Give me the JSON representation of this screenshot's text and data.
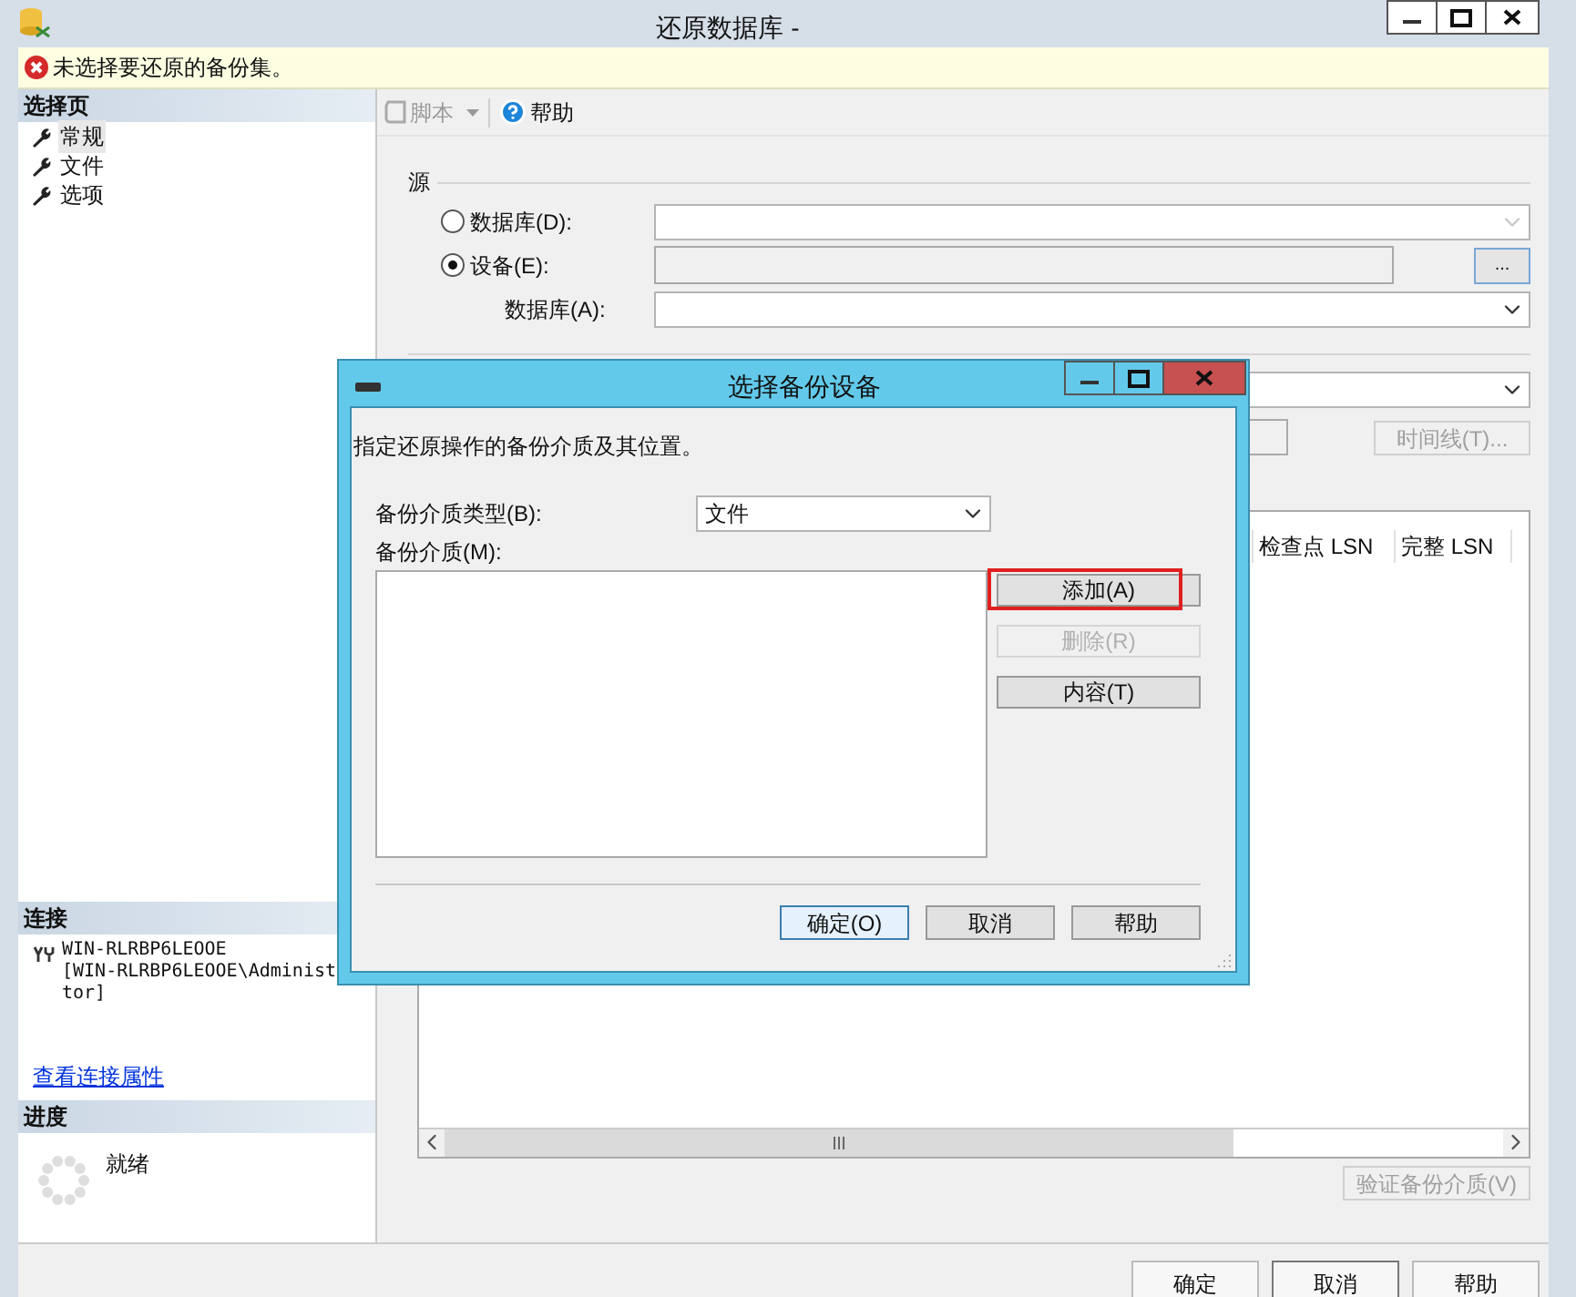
{
  "window": {
    "title": "还原数据库 -"
  },
  "error": {
    "message": "未选择要还原的备份集。"
  },
  "sidebar": {
    "header": "选择页",
    "items": [
      {
        "label": "常规",
        "selected": true
      },
      {
        "label": "文件",
        "selected": false
      },
      {
        "label": "选项",
        "selected": false
      }
    ]
  },
  "connection": {
    "header": "连接",
    "lines": [
      "WIN-RLRBP6LEOOE",
      "[WIN-RLRBP6LEOOE\\Administ",
      "tor]"
    ],
    "link": "查看连接属性"
  },
  "progress": {
    "header": "进度",
    "status": "就绪"
  },
  "toolbar": {
    "script": "脚本",
    "help": "帮助"
  },
  "source": {
    "title": "源",
    "options": [
      {
        "label": "数据库(D):",
        "selected": false
      },
      {
        "label": "设备(E):",
        "selected": true
      }
    ],
    "database_label": "数据库(A):",
    "browse": "..."
  },
  "destination": {
    "timeline_button": "时间线(T)..."
  },
  "grid": {
    "columns": [
      "检查点 LSN",
      "完整 LSN"
    ]
  },
  "verify_button": "验证备份介质(V)",
  "buttons": [
    "确定",
    "取消",
    "帮助"
  ],
  "dialog": {
    "title": "选择备份设备",
    "instruction": "指定还原操作的备份介质及其位置。",
    "media_type_label": "备份介质类型(B):",
    "media_type_value": "文件",
    "media_label": "备份介质(M):",
    "side_buttons": [
      {
        "label": "添加(A)",
        "disabled": false,
        "highlighted": true
      },
      {
        "label": "删除(R)",
        "disabled": true,
        "highlighted": false
      },
      {
        "label": "内容(T)",
        "disabled": false,
        "highlighted": false
      }
    ],
    "buttons": [
      {
        "label": "确定(O)",
        "default": true
      },
      {
        "label": "取消",
        "default": false
      },
      {
        "label": "帮助",
        "default": false
      }
    ]
  }
}
